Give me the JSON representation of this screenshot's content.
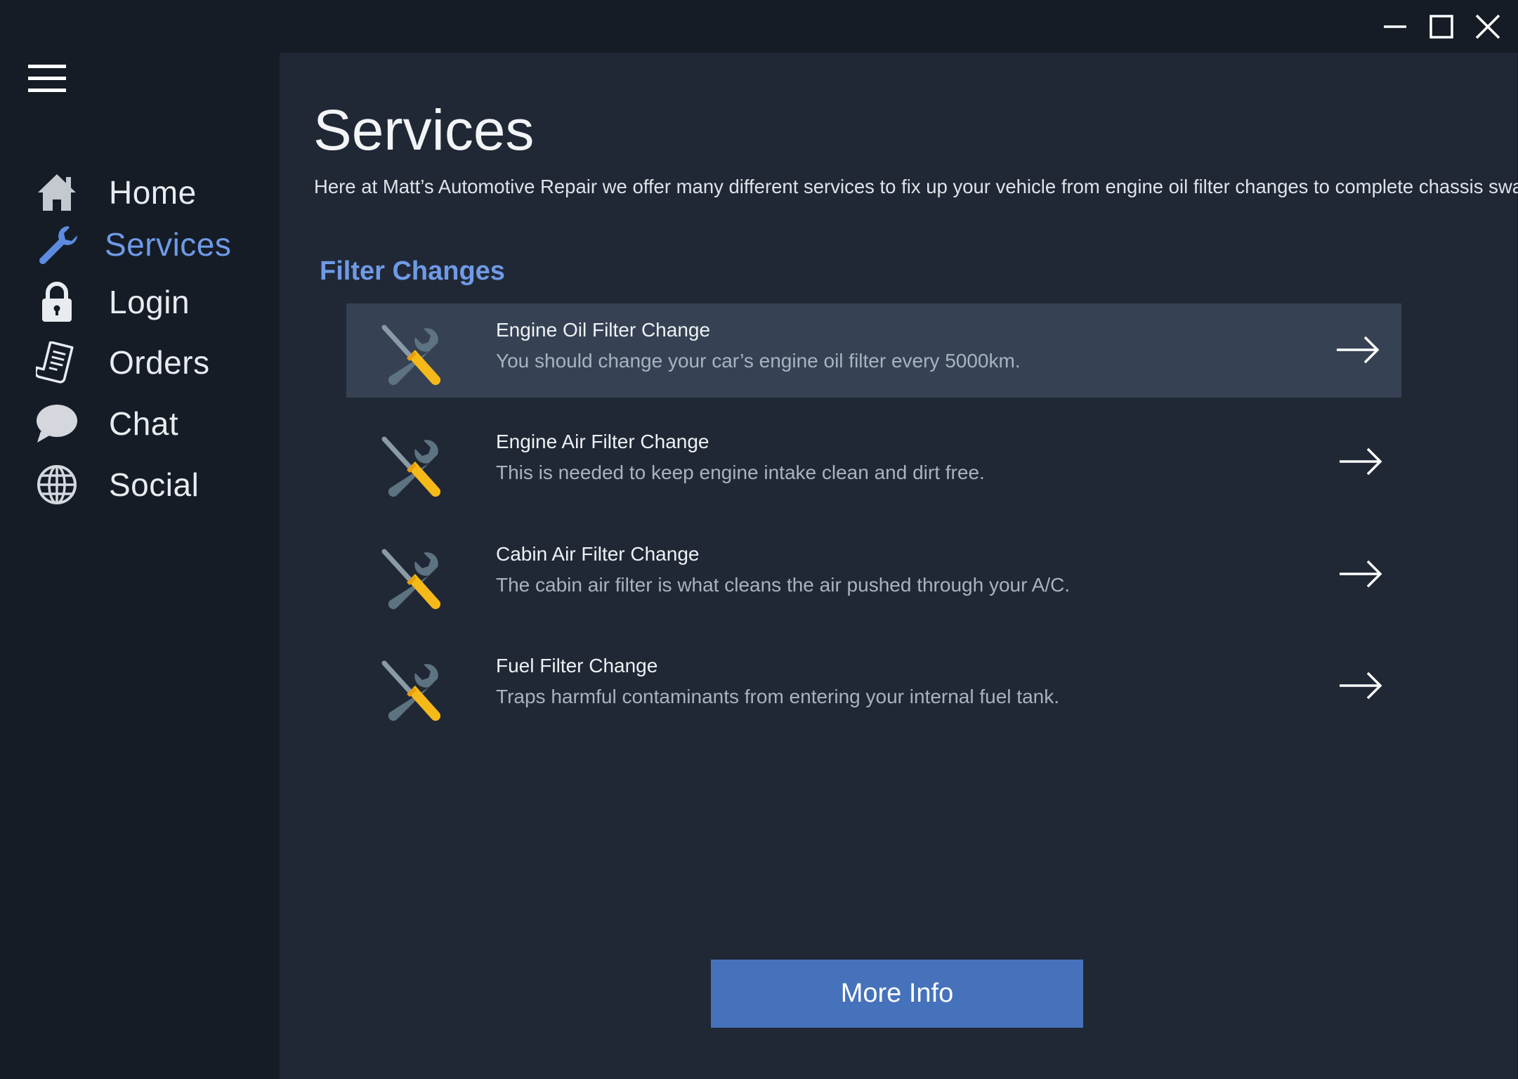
{
  "window": {
    "controls": {
      "minimize": "minimize-icon",
      "maximize": "maximize-icon",
      "close": "close-icon"
    }
  },
  "sidebar": {
    "menu_icon": "hamburger-icon",
    "items": [
      {
        "label": "Home",
        "icon": "home-icon",
        "active": false
      },
      {
        "label": "Services",
        "icon": "wrench-icon",
        "active": true
      },
      {
        "label": "Login",
        "icon": "lock-icon",
        "active": false
      },
      {
        "label": "Orders",
        "icon": "receipt-icon",
        "active": false
      },
      {
        "label": "Chat",
        "icon": "chat-bubble-icon",
        "active": false
      },
      {
        "label": "Social",
        "icon": "globe-icon",
        "active": false
      }
    ]
  },
  "main": {
    "title": "Services",
    "description": "Here at Matt’s Automotive Repair we offer many different services to fix up your vehicle from engine oil filter changes to complete chassis swaps",
    "section_title": "Filter Changes",
    "services": [
      {
        "title": "Engine Oil Filter Change",
        "description": "You should change your car’s engine oil filter every 5000km.",
        "icon": "tools-icon",
        "selected": true
      },
      {
        "title": "Engine Air Filter Change",
        "description": "This is needed to keep engine intake clean and dirt free.",
        "icon": "tools-icon",
        "selected": false
      },
      {
        "title": "Cabin Air Filter Change",
        "description": "The cabin air filter is what cleans the air pushed through your A/C.",
        "icon": "tools-icon",
        "selected": false
      },
      {
        "title": "Fuel Filter Change",
        "description": "Traps harmful contaminants from entering your internal fuel tank.",
        "icon": "tools-icon",
        "selected": false
      }
    ],
    "more_info_label": "More Info"
  },
  "colors": {
    "sidebar_bg": "#151c26",
    "main_bg": "#202835",
    "selected_row_bg": "#364253",
    "accent": "#6f9ae6",
    "button_bg": "#4672bb",
    "tool_handle": "#f6b91a",
    "tool_metal": "#5e7381"
  }
}
